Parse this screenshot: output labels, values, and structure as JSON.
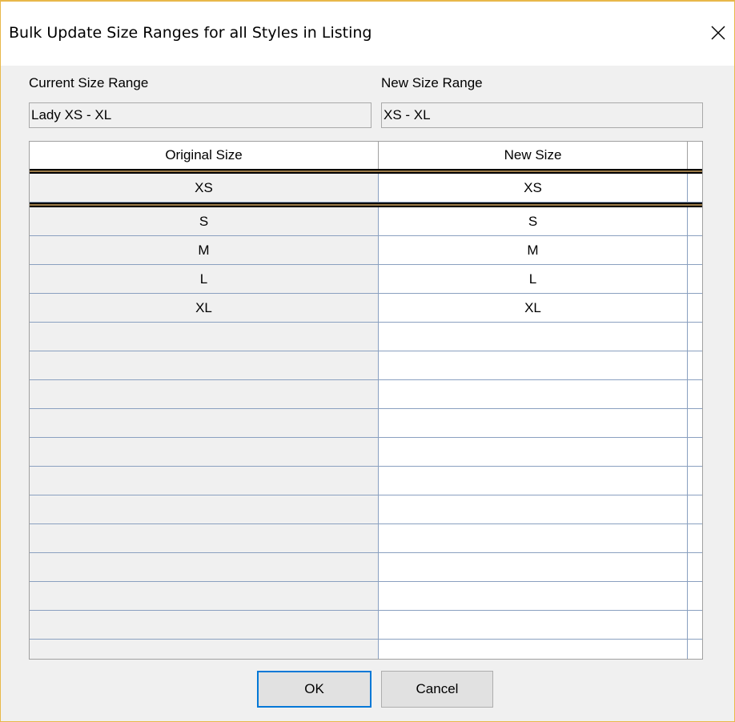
{
  "window": {
    "title": "Bulk Update Size Ranges for all Styles in Listing",
    "close_glyph": "✕"
  },
  "fields": {
    "current_label": "Current Size Range",
    "current_value": "Lady XS - XL",
    "new_label": "New Size Range",
    "new_value": "XS - XL"
  },
  "grid": {
    "columns": [
      "Original Size",
      "New Size",
      ""
    ],
    "rows": [
      {
        "original": "XS",
        "new": "XS"
      },
      {
        "original": "S",
        "new": "S"
      },
      {
        "original": "M",
        "new": "M"
      },
      {
        "original": "L",
        "new": "L"
      },
      {
        "original": "XL",
        "new": "XL"
      },
      {
        "original": "",
        "new": ""
      },
      {
        "original": "",
        "new": ""
      },
      {
        "original": "",
        "new": ""
      },
      {
        "original": "",
        "new": ""
      },
      {
        "original": "",
        "new": ""
      },
      {
        "original": "",
        "new": ""
      },
      {
        "original": "",
        "new": ""
      },
      {
        "original": "",
        "new": ""
      },
      {
        "original": "",
        "new": ""
      },
      {
        "original": "",
        "new": ""
      },
      {
        "original": "",
        "new": ""
      },
      {
        "original": "",
        "new": ""
      }
    ],
    "separator_color": "#9b7b48"
  },
  "buttons": {
    "ok_label": "OK",
    "cancel_label": "Cancel"
  },
  "colors": {
    "window_border": "#e8b84a",
    "default_button_border": "#0078d7",
    "grid_line": "#8aa0c0"
  }
}
